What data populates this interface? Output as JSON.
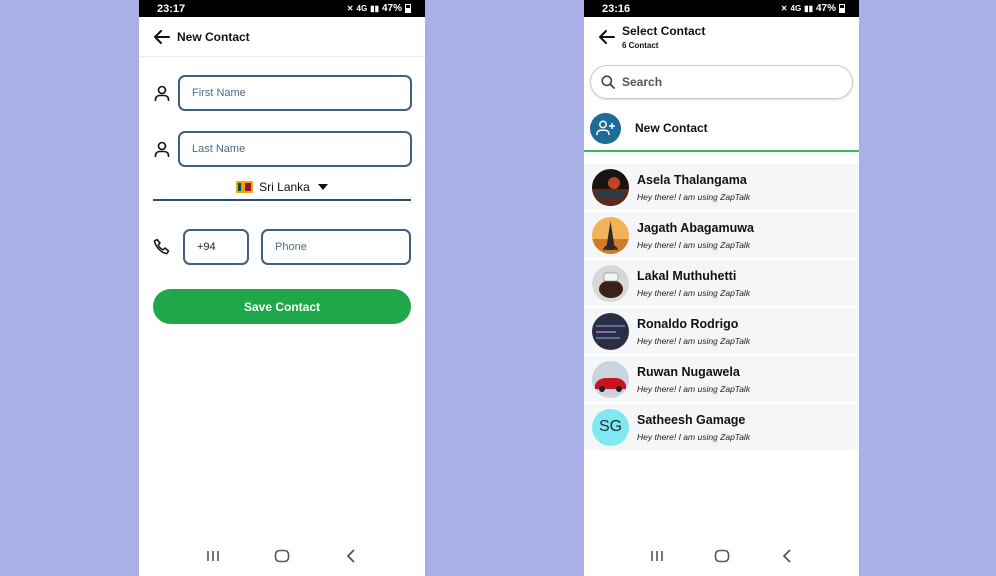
{
  "new_contact_screen": {
    "status": {
      "time": "23:17",
      "signal": "4G",
      "battery": "47%"
    },
    "header": {
      "title": "New Contact"
    },
    "first_name": {
      "placeholder": "First Name"
    },
    "last_name": {
      "placeholder": "Last Name"
    },
    "country": {
      "name": "Sri Lanka"
    },
    "country_code": {
      "value": "+94"
    },
    "phone": {
      "placeholder": "Phone"
    },
    "save_label": "Save Contact"
  },
  "select_contact_screen": {
    "status": {
      "time": "23:16",
      "signal": "4G",
      "battery": "47%"
    },
    "header": {
      "title": "Select Contact",
      "subtitle": "6 Contact"
    },
    "search": {
      "placeholder": "Search"
    },
    "new_contact_label": "New Contact",
    "contacts": [
      {
        "name": "Asela Thalangama",
        "status": "Hey there! I am using ZapTalk"
      },
      {
        "name": "Jagath Abagamuwa",
        "status": "Hey there! I am using ZapTalk"
      },
      {
        "name": "Lakal Muthuhetti",
        "status": "Hey there! I am using ZapTalk"
      },
      {
        "name": "Ronaldo Rodrigo",
        "status": "Hey there! I am using ZapTalk"
      },
      {
        "name": "Ruwan Nugawela",
        "status": "Hey there! I am using ZapTalk"
      },
      {
        "name": "Satheesh Gamage",
        "status": "Hey there! I am using ZapTalk",
        "initials": "SG"
      }
    ]
  },
  "colors": {
    "background": "#a9b0e6",
    "accent_green": "#1ea84a",
    "input_border": "#3e5f82",
    "avatar_blue": "#1f6b98",
    "initials_bg": "#7fe8f0"
  }
}
